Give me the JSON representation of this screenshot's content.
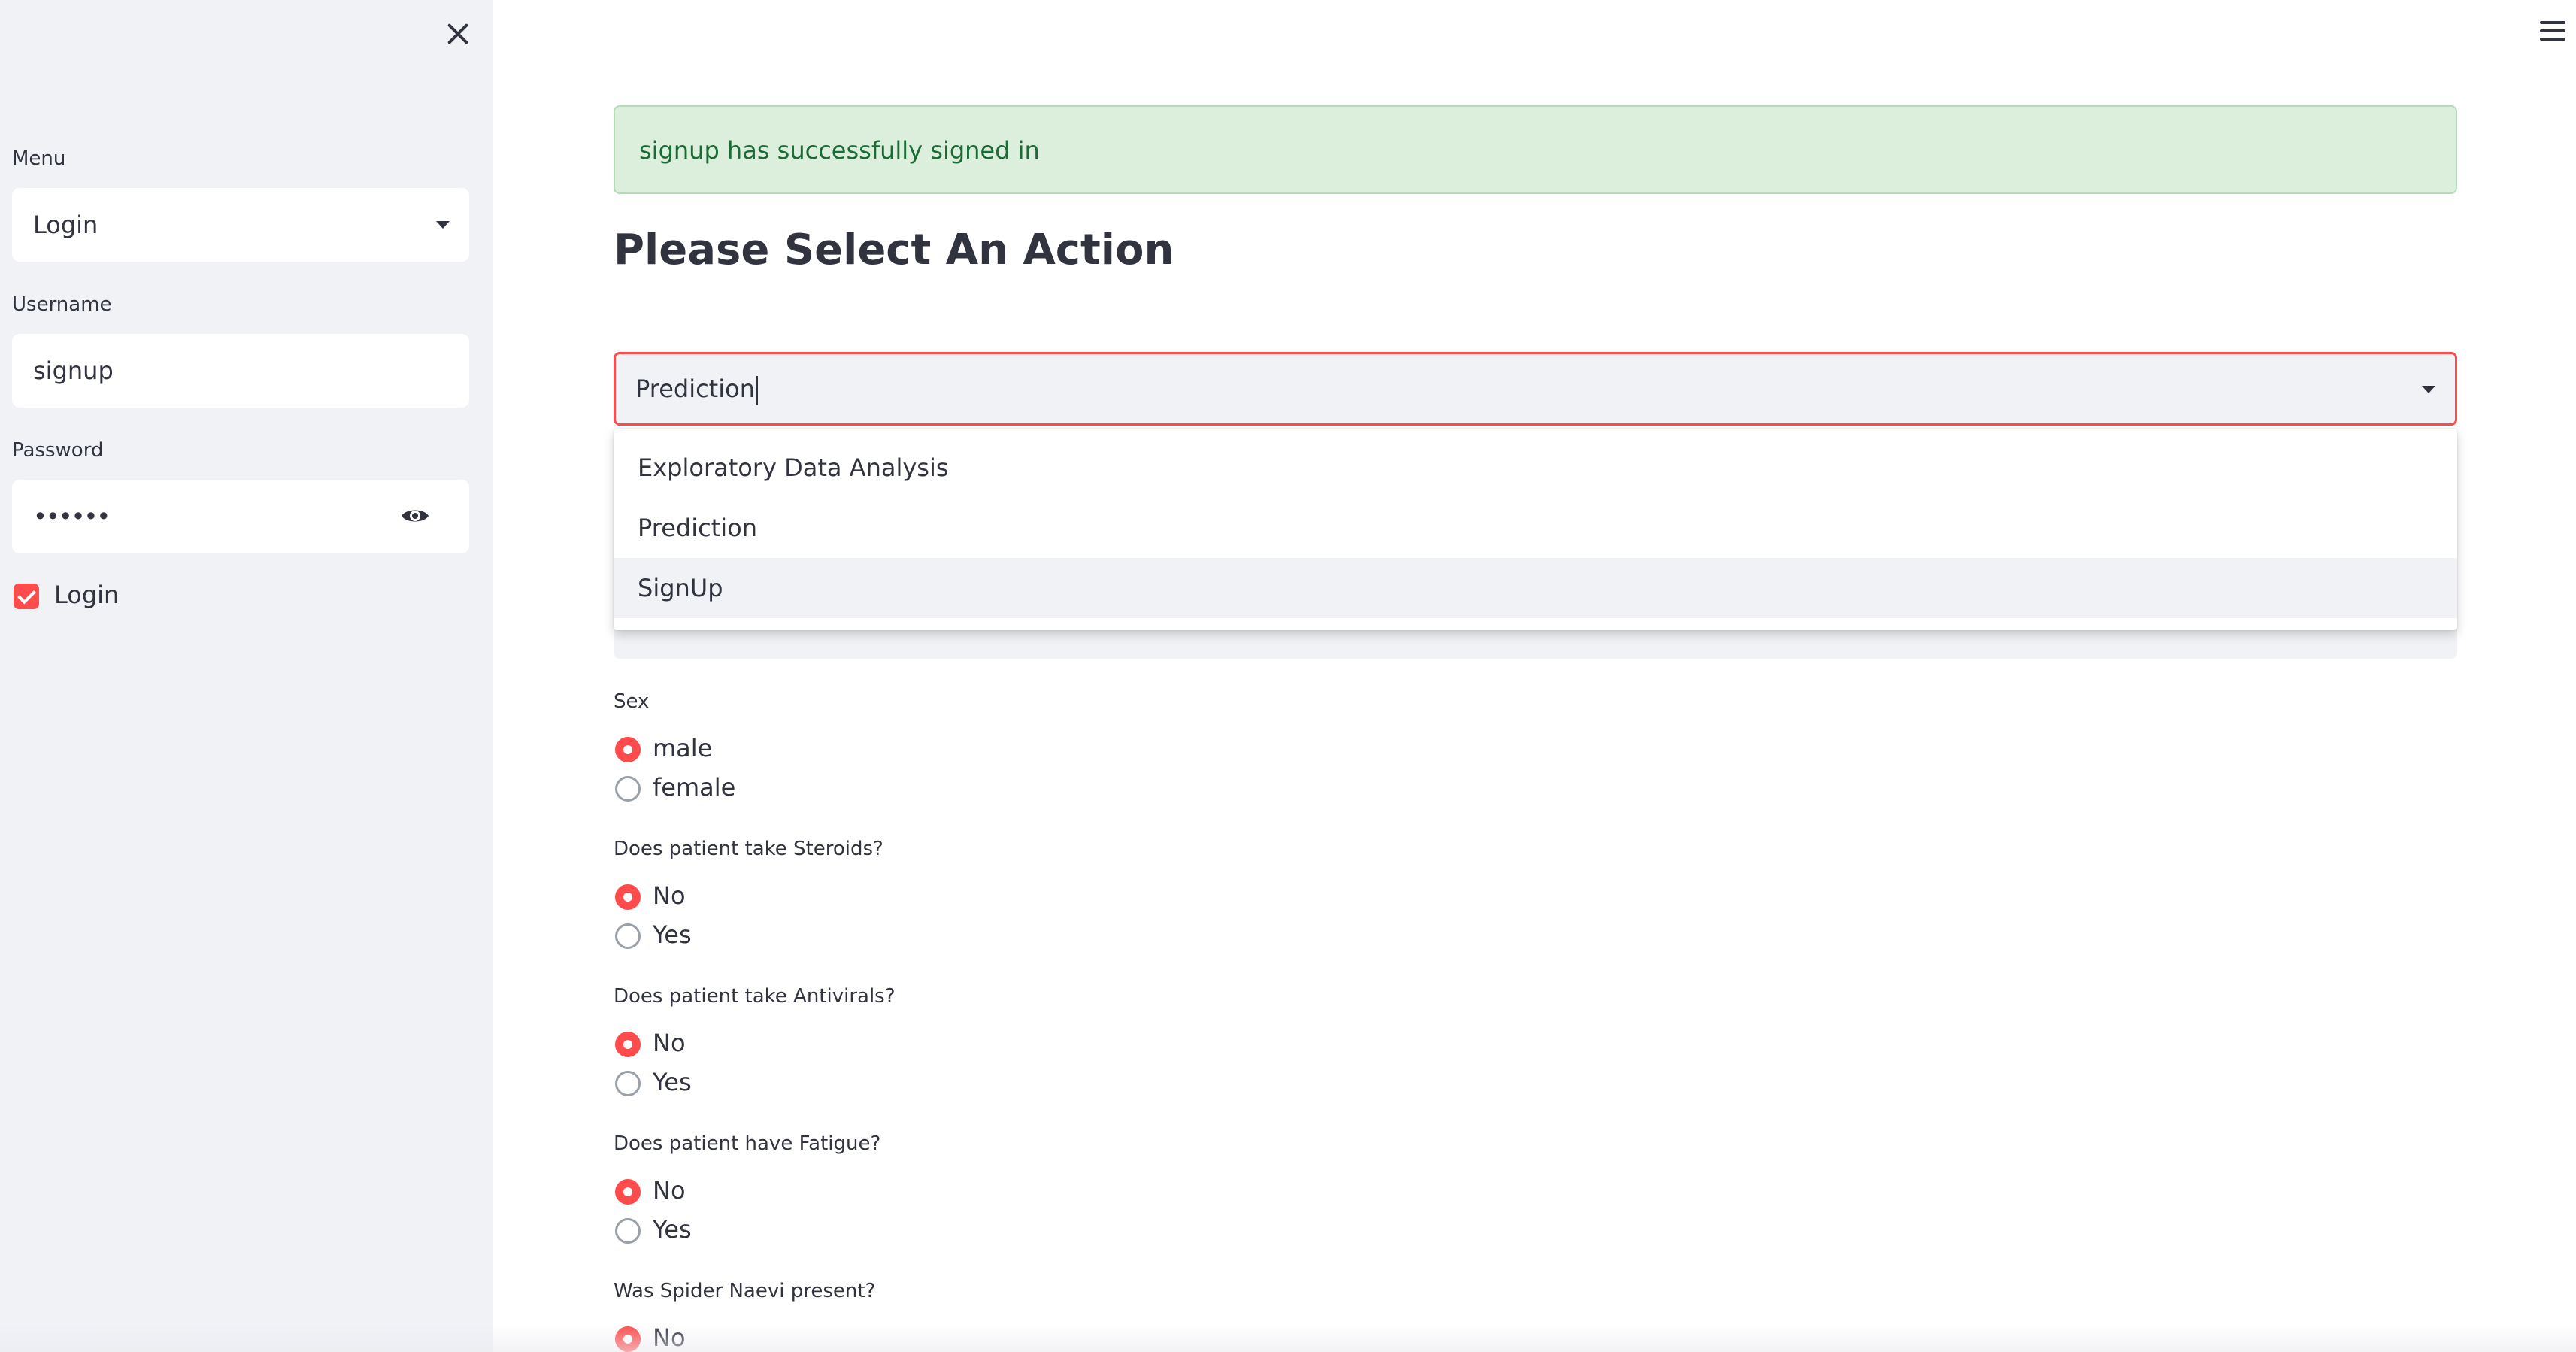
{
  "sidebar": {
    "menu_label": "Menu",
    "menu_value": "Login",
    "username_label": "Username",
    "username_value": "signup",
    "password_label": "Password",
    "password_value": "••••••",
    "login_checkbox_label": "Login",
    "login_checked": true
  },
  "main": {
    "success_message": "signup has successfully signed in",
    "heading": "Please Select An Action",
    "action_select_value": "Prediction",
    "dropdown_options": [
      "Exploratory Data Analysis",
      "Prediction",
      "SignUp"
    ],
    "highlighted_option": "SignUp",
    "questions": [
      {
        "label": "Sex",
        "options": [
          "male",
          "female"
        ],
        "selected": "male"
      },
      {
        "label": "Does patient take Steroids?",
        "options": [
          "No",
          "Yes"
        ],
        "selected": "No"
      },
      {
        "label": "Does patient take Antivirals?",
        "options": [
          "No",
          "Yes"
        ],
        "selected": "No"
      },
      {
        "label": "Does patient have Fatigue?",
        "options": [
          "No",
          "Yes"
        ],
        "selected": "No"
      },
      {
        "label": "Was Spider Naevi present?",
        "options": [
          "No"
        ],
        "selected": "No"
      }
    ]
  },
  "colors": {
    "accent": "#ff4b4b",
    "sidebar_bg": "#f0f2f6",
    "success_bg": "#dcefdc",
    "success_text": "#1a6b35",
    "text": "#31333f"
  },
  "icons": {
    "close": "close-icon",
    "menu": "hamburger-icon",
    "password_toggle": "eye-icon",
    "dropdown": "chevron-down-icon"
  }
}
